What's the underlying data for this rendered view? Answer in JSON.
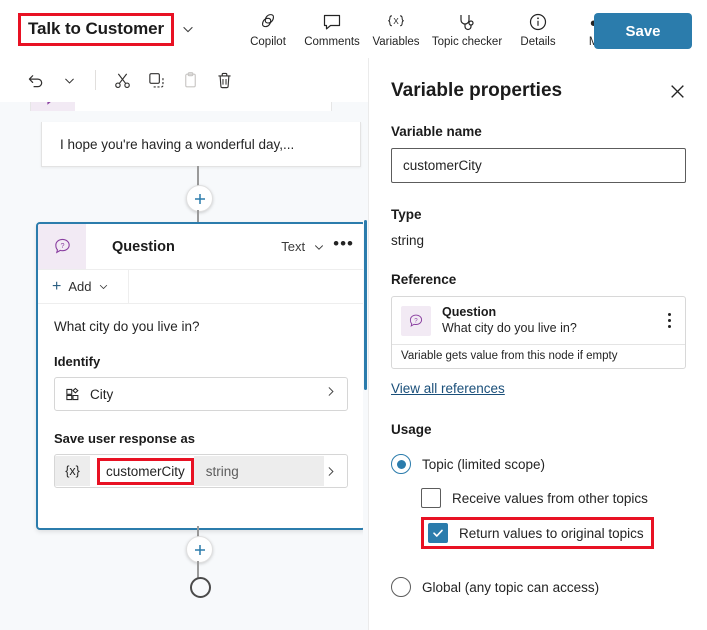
{
  "topbar": {
    "topic_title": "Talk to Customer",
    "topic_title_chevron_icon": "chevron-down-icon",
    "commands": [
      {
        "label": "Copilot",
        "icon": "copilot-icon"
      },
      {
        "label": "Comments",
        "icon": "comment-bubble-icon"
      },
      {
        "label": "Variables",
        "icon": "variables-braces-icon"
      },
      {
        "label": "Topic checker",
        "icon": "topic-checker-icon"
      },
      {
        "label": "Details",
        "icon": "info-circle-icon"
      },
      {
        "label": "More",
        "icon": "ellipsis-icon"
      }
    ],
    "save_label": "Save",
    "save_color": "#2b7cac"
  },
  "canvas_toolbar": {
    "undo": "undo-icon",
    "undo_chevron": "chevron-down-icon",
    "cut": "scissors-icon",
    "copy": "copy-icon",
    "paste": "paste-icon",
    "delete": "trash-icon"
  },
  "canvas": {
    "message_node": {
      "text": "I hope you're having a wonderful day,..."
    },
    "question_node": {
      "icon": "question-bubble-icon",
      "title": "Question",
      "response_type": "Text",
      "type_chevron_icon": "chevron-down-icon",
      "overflow_icon": "ellipsis-icon",
      "add_label": "Add",
      "add_plus_icon": "plus-icon",
      "add_chevron_icon": "chevron-down-icon",
      "prompt": "What city do you live in?",
      "identify_label": "Identify",
      "identify_value": "City",
      "identify_icon": "entity-icon",
      "identify_chevron_icon": "chevron-right-icon",
      "save_as_label": "Save user response as",
      "variable_brace": "{x}",
      "variable_name": "customerCity",
      "variable_type": "string",
      "variable_chevron_icon": "chevron-right-icon",
      "selected_border_color": "#2b7cac"
    },
    "add_node_icon": "plus-circle-icon",
    "end_node_icon": "end-circle-icon"
  },
  "panel": {
    "title": "Variable properties",
    "close_icon": "close-icon",
    "variable_name_label": "Variable name",
    "variable_name_value": "customerCity",
    "type_label": "Type",
    "type_value": "string",
    "reference_label": "Reference",
    "reference_card": {
      "icon": "question-bubble-icon",
      "node_title": "Question",
      "node_subtitle": "What city do you live in?",
      "overflow_icon": "more-vertical-icon",
      "footer": "Variable gets value from this node if empty"
    },
    "view_all_references": "View all references",
    "usage_label": "Usage",
    "usage_options": [
      {
        "label": "Topic (limited scope)",
        "control": "radio",
        "selected": true,
        "children": [
          {
            "label": "Receive values from other topics",
            "control": "checkbox",
            "checked": false,
            "highlighted": false
          },
          {
            "label": "Return values to original topics",
            "control": "checkbox",
            "checked": true,
            "highlighted": true
          }
        ]
      },
      {
        "label": "Global (any topic can access)",
        "control": "radio",
        "selected": false,
        "children": []
      }
    ]
  },
  "annotations": {
    "highlight_color": "#e81123",
    "boxes": [
      "topic-title",
      "question-node-variable-name",
      "return-values-checkbox-row"
    ]
  }
}
